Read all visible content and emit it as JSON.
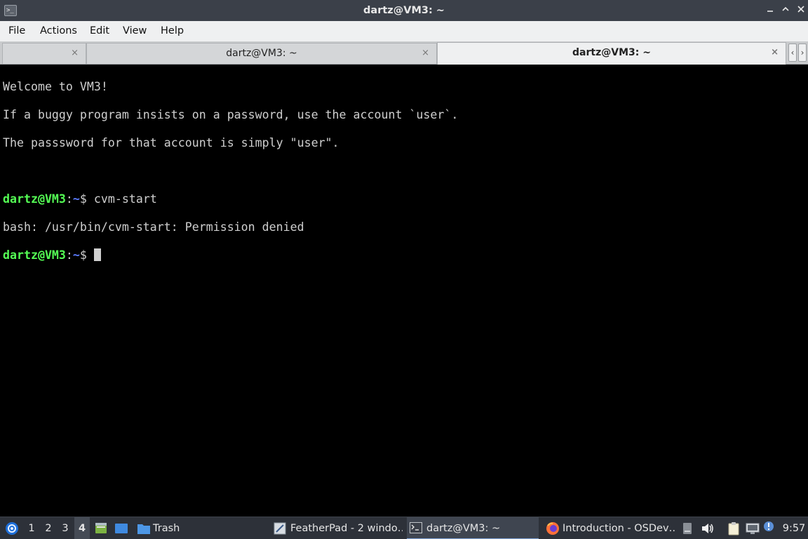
{
  "window": {
    "title": "dartz@VM3: ~",
    "icons": {
      "app": "terminal-icon",
      "minimize": "minimize-icon",
      "maximize": "maximize-icon",
      "close": "close-icon"
    }
  },
  "menu": {
    "items": [
      "File",
      "Actions",
      "Edit",
      "View",
      "Help"
    ]
  },
  "tabs": [
    {
      "label": "",
      "close": "×"
    },
    {
      "label": "dartz@VM3: ~",
      "close": "×"
    },
    {
      "label": "dartz@VM3: ~",
      "close": "×",
      "active": true
    }
  ],
  "tab_scroll": {
    "left": "‹",
    "right": "›"
  },
  "terminal": {
    "colors": {
      "user": "#55ff55",
      "path": "#5c7cff",
      "text": "#cfcfcf"
    },
    "lines": [
      {
        "text": "Welcome to VM3!"
      },
      {
        "text": "If a buggy program insists on a password, use the account `user`."
      },
      {
        "text": "The passsword for that account is simply \"user\"."
      },
      {
        "text": ""
      },
      {
        "prompt_user": "dartz@VM3",
        "prompt_sep": ":",
        "prompt_path": "~",
        "prompt_end": "$ ",
        "command": "cvm-start"
      },
      {
        "text": "bash: /usr/bin/cvm-start: Permission denied"
      },
      {
        "prompt_user": "dartz@VM3",
        "prompt_sep": ":",
        "prompt_path": "~",
        "prompt_end": "$ ",
        "command": ""
      }
    ]
  },
  "taskbar": {
    "start_icon": "lubuntu-logo-icon",
    "workspaces": [
      "1",
      "2",
      "3",
      "4"
    ],
    "active_workspace": "4",
    "quicklaunch": [
      "file-manager-icon",
      "desktop-icon"
    ],
    "trash_label": "Trash",
    "tasks": [
      {
        "label": "FeatherPad - 2 windo…",
        "icon": "featherpad-icon"
      },
      {
        "label": "dartz@VM3: ~",
        "icon": "terminal-icon",
        "active": true
      },
      {
        "label": "Introduction - OSDev…",
        "icon": "firefox-icon"
      }
    ],
    "tray_icons": [
      "disk-icon",
      "volume-icon",
      "clipboard-icon",
      "network-icon",
      "notification-icon"
    ],
    "clock": "9:57"
  }
}
